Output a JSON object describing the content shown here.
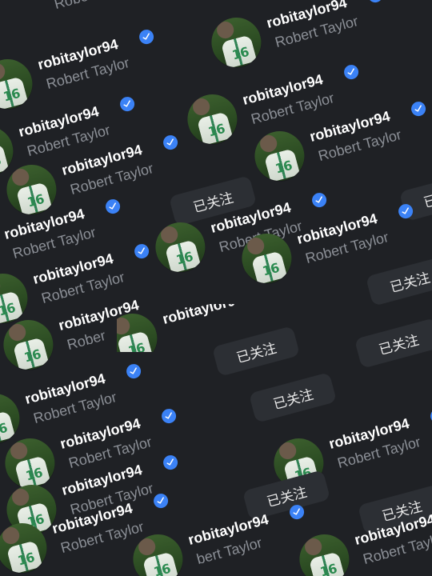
{
  "profile": {
    "username": "robitaylor94",
    "display_name": "Robert Taylor",
    "jersey_number": "16",
    "verified_icon": "verified-check-icon",
    "accent_color": "#3b82f6"
  },
  "actions": {
    "followed_label": "已关注"
  },
  "fragments": {
    "name_cut_1": "robitaylor94",
    "name_cut_2": "robitaylor94",
    "handle_cut_1": "Rober",
    "handle_cut_2": "bert Taylor",
    "handle_cut_3": "Robert Taylor",
    "handle_cut_4": "Robert Taylo"
  }
}
